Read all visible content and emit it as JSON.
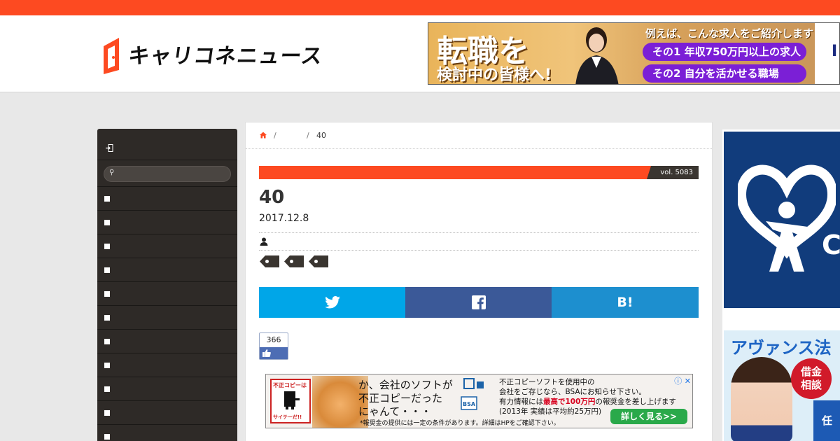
{
  "header": {
    "logo_text": "キャリコネニュース",
    "banner": {
      "headline": "転職を",
      "subline": "検討中の皆様へ!",
      "top_text": "例えば、こんな求人をご紹介します!",
      "pill1": "その1 年収750万円以上の求人",
      "pill2": "その2 自分を活かせる職場"
    }
  },
  "sidebar": {
    "item_count": 11
  },
  "breadcrumb": {
    "sep": "/",
    "current": "40"
  },
  "article": {
    "vol": "vol. 5083",
    "title": "40",
    "date": "2017.12.8"
  },
  "share": {
    "hatena_label": "B!"
  },
  "like": {
    "count": "366"
  },
  "ad": {
    "poster_top": "不正コピーは",
    "poster_bottom": "サイテーだ!!",
    "line1": "か、会社のソフトが",
    "line2": "不正コピーだった",
    "line3": "にゃんて・・・",
    "info1": "不正コピーソフトを使用中の",
    "info2": "会社をご存じなら、BSAにお知らせ下さい。",
    "info3_a": "有力情報には",
    "info3_red": "最高で100万円",
    "info3_b": "の報奨金を差し上げます",
    "info4": "(2013年 実績は平均約25万円)",
    "note": "*報奨金の提供には一定の条件があります。詳細はHPをご確認下さい。",
    "cta": "詳しく見る>>",
    "bsa_label": "BSA"
  },
  "right_ads": {
    "ad1_letter": "C",
    "ad2_head": "アヴァンス法",
    "ad2_badge1": "借金",
    "ad2_badge2": "相談",
    "ad2_tail": "任"
  },
  "colors": {
    "accent": "#fd4a21",
    "sidebar": "#2e2a27",
    "twitter": "#00a6e8",
    "facebook": "#3b5998",
    "hatena": "#1d8fcf"
  }
}
